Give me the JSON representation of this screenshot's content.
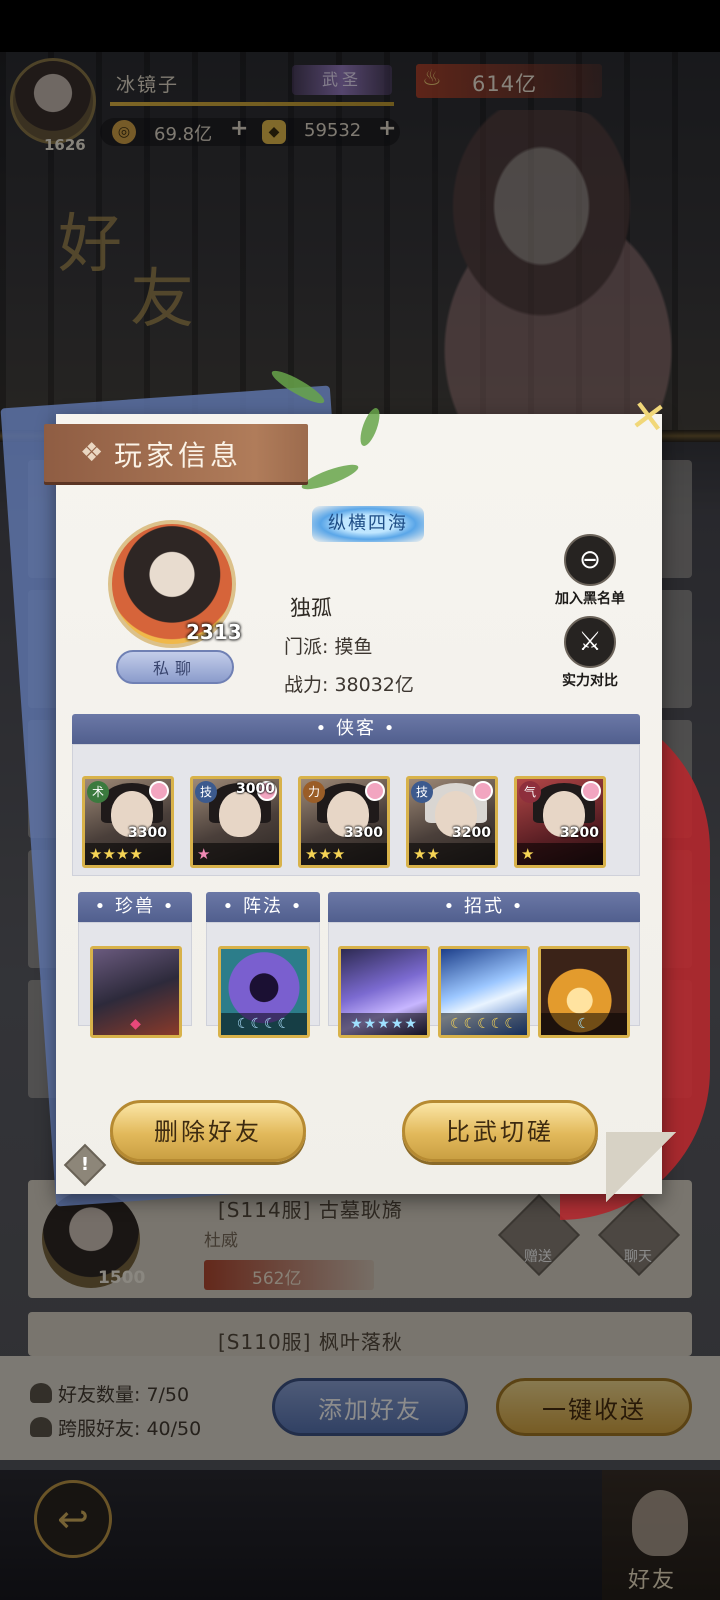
{
  "topbar": {
    "player_name": "冰镜子",
    "level": "1626",
    "rank": "武圣",
    "power": "614亿",
    "copper": "69.8亿",
    "gold": "59532",
    "plus": "+"
  },
  "background": {
    "title_a": "好",
    "title_b": "友",
    "rows": [
      {
        "server": "[S114服] 古墓耿旖",
        "guild": "杜威",
        "level": "1500",
        "power": "562亿",
        "gift": "赠送",
        "chat": "聊天"
      },
      {
        "server": "[S110服] 枫叶落秋"
      }
    ],
    "friend_count_label": "好友数量: 7/50",
    "cross_friend_label": "跨服好友: 40/50",
    "add_friend": "添加好友",
    "one_click_send": "一键收送",
    "nav_friends": "好友"
  },
  "modal": {
    "header": "玩家信息",
    "title_badge": "纵横四海",
    "level": "2313",
    "private_chat": "私聊",
    "name": "独孤",
    "sect": "门派: 摸鱼",
    "power": "战力: 38032亿",
    "blacklist": "加入黑名单",
    "compare": "实力对比",
    "heroes_title": "侠客",
    "pet_title": "珍兽",
    "formation_title": "阵法",
    "skills_title": "招式",
    "heroes": [
      {
        "type": "术",
        "value": "3300",
        "stars": "★★★★",
        "type_color": "#3b7a3e"
      },
      {
        "type": "技",
        "value": "3000",
        "stars": "★",
        "type_color": "#3c5a8e"
      },
      {
        "type": "力",
        "value": "3300",
        "stars": "★★★",
        "type_color": "#9a5d27"
      },
      {
        "type": "技",
        "value": "3200",
        "stars": "★★",
        "type_color": "#3c5a8e"
      },
      {
        "type": "气",
        "value": "3200",
        "stars": "★",
        "type_color": "#8e2f3c"
      }
    ],
    "formation_moons": "☾☾☾☾",
    "skill_caps": [
      "★★★★★",
      "☾☾☾☾☾",
      "☾"
    ],
    "delete_friend": "删除好友",
    "spar": "比武切磋",
    "warn": "!"
  }
}
